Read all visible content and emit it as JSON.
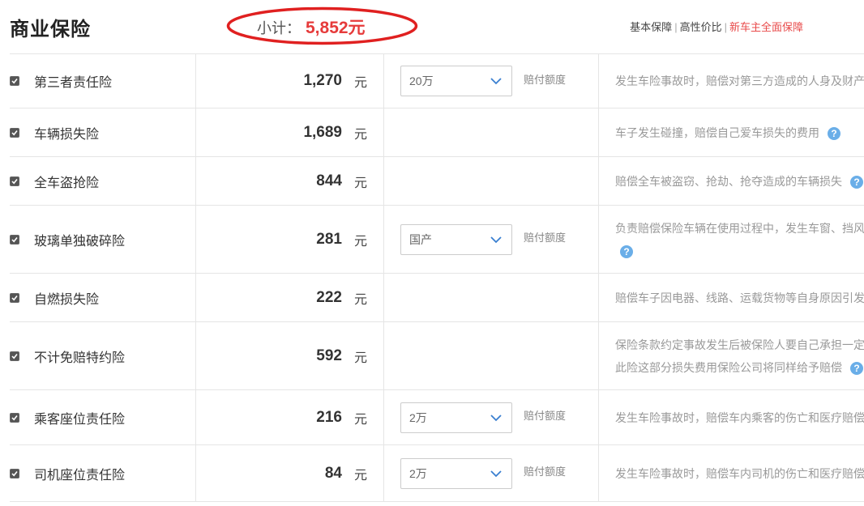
{
  "header": {
    "title": "商业保险",
    "subtotal_label": "小计：",
    "subtotal_amount": "5,852元",
    "plans": [
      "基本保障",
      "高性价比",
      "新车主全面保障"
    ],
    "active_plan_index": 2,
    "accent_color": "#e63b3b"
  },
  "rows": [
    {
      "name": "第三者责任险",
      "price": "1,270",
      "unit": "元",
      "checked": true,
      "option": "20万",
      "option_note": "赔付额度",
      "desc_lines": [
        "发生车险事故时，赔偿对第三方造成的人身及财产"
      ],
      "help": false
    },
    {
      "name": "车辆损失险",
      "price": "1,689",
      "unit": "元",
      "checked": true,
      "option": null,
      "option_note": null,
      "desc_lines": [
        "车子发生碰撞，赔偿自己爱车损失的费用"
      ],
      "help": true
    },
    {
      "name": "全车盗抢险",
      "price": "844",
      "unit": "元",
      "checked": true,
      "option": null,
      "option_note": null,
      "desc_lines": [
        "赔偿全车被盗窃、抢劫、抢夺造成的车辆损失"
      ],
      "help": true
    },
    {
      "name": "玻璃单独破碎险",
      "price": "281",
      "unit": "元",
      "checked": true,
      "option": "国产",
      "option_note": "赔付额度",
      "desc_lines": [
        "负责赔偿保险车辆在使用过程中，发生车窗、挡风",
        ""
      ],
      "help": true
    },
    {
      "name": "自燃损失险",
      "price": "222",
      "unit": "元",
      "checked": true,
      "option": null,
      "option_note": null,
      "desc_lines": [
        "赔偿车子因电器、线路、运载货物等自身原因引发"
      ],
      "help": false
    },
    {
      "name": "不计免赔特约险",
      "price": "592",
      "unit": "元",
      "checked": true,
      "option": null,
      "option_note": null,
      "desc_lines": [
        "保险条款约定事故发生后被保险人要自己承担一定",
        "此险这部分损失费用保险公司将同样给予赔偿"
      ],
      "help": true
    },
    {
      "name": "乘客座位责任险",
      "price": "216",
      "unit": "元",
      "checked": true,
      "option": "2万",
      "option_note": "赔付额度",
      "desc_lines": [
        "发生车险事故时，赔偿车内乘客的伤亡和医疗赔偿"
      ],
      "help": false
    },
    {
      "name": "司机座位责任险",
      "price": "84",
      "unit": "元",
      "checked": true,
      "option": "2万",
      "option_note": "赔付额度",
      "desc_lines": [
        "发生车险事故时，赔偿车内司机的伤亡和医疗赔偿"
      ],
      "help": false
    }
  ],
  "help_glyph": "?"
}
